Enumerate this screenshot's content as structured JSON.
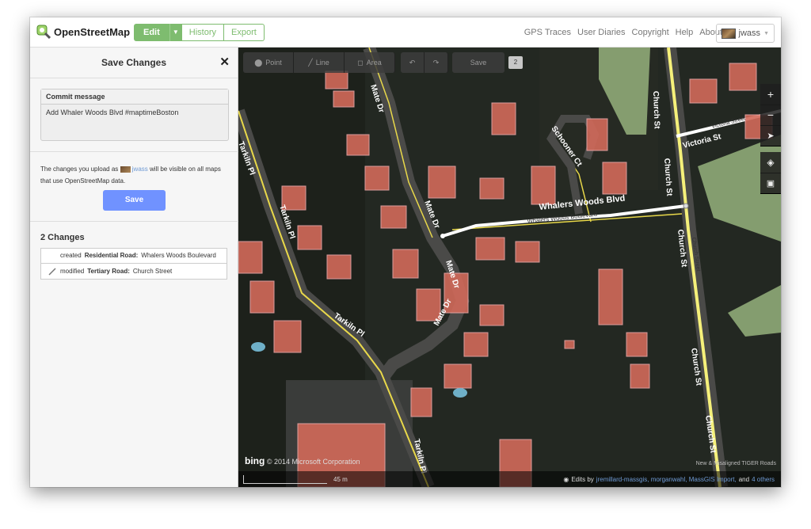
{
  "app": {
    "logo_text": "OpenStreetMap",
    "edit_label": "Edit",
    "history_label": "History",
    "export_label": "Export",
    "nav": [
      "GPS Traces",
      "User Diaries",
      "Copyright",
      "Help",
      "About"
    ],
    "username": "jwass"
  },
  "sidebar": {
    "title": "Save Changes",
    "commit_label": "Commit message",
    "commit_value": "Add Whaler Woods Blvd #maptimeBoston",
    "upload_prefix": "The changes you upload as",
    "upload_user": "jwass",
    "upload_suffix": "will be visible on all maps that use OpenStreetMap data.",
    "save_label": "Save",
    "changes_title": "2 Changes",
    "changes": [
      {
        "action": "created",
        "type": "Residential Road:",
        "name": "Whalers Woods Boulevard",
        "icon": "area-icon"
      },
      {
        "action": "modified",
        "type": "Tertiary Road:",
        "name": "Church Street",
        "icon": "line-icon"
      }
    ]
  },
  "map": {
    "tools": {
      "point": "Point",
      "line": "Line",
      "area": "Area",
      "save": "Save",
      "count": "2"
    },
    "labels": {
      "mate_dr": "Mate Dr",
      "tarkiln_pl": "Tarkiln Pl",
      "church_st": "Church St",
      "church_street": "Church Street",
      "victoria_st": "Victoria St",
      "victoria_street": "Victoria Street",
      "schooner_ct": "Schooner Ct",
      "whalers_blvd": "Whalers Woods Blvd",
      "whalers_boulevard": "Whalers Woods Boulevard"
    },
    "bing_logo": "bing",
    "bing_copyright": "© 2014 Microsoft Corporation",
    "tiger_note": "New & Misaligned TIGER Roads",
    "scale": "45 m",
    "attribution_prefix": "Edits by",
    "attribution_users": "jremillard-massgis, morganwahl, MassGIS Import,",
    "attribution_and": "and",
    "attribution_others": "4 others",
    "colors": {
      "highlight_road": "#ffffff",
      "major_road": "#f5f07a",
      "building": "#d26a5a"
    }
  }
}
